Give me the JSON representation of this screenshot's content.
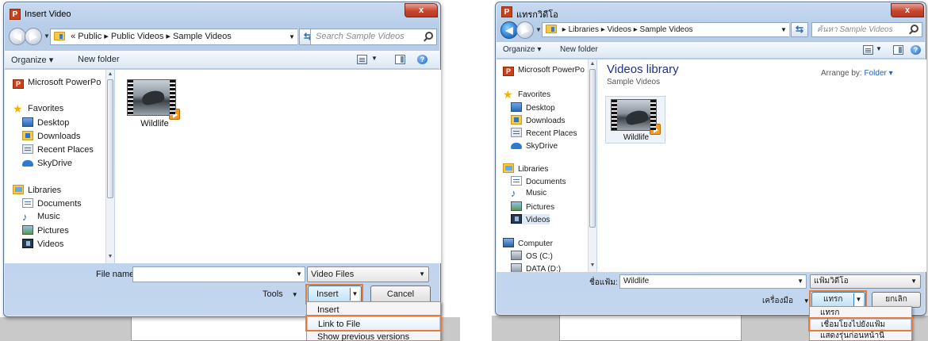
{
  "left": {
    "title": "Insert Video",
    "address": {
      "overflow": "«",
      "crumbs": [
        "Public",
        "Public Videos",
        "Sample Videos"
      ],
      "separator": "▸"
    },
    "search_placeholder": "Search Sample Videos",
    "toolbar": {
      "organize": "Organize ▾",
      "new_folder": "New folder"
    },
    "nav": {
      "pinned": "Microsoft PowerPo",
      "favorites": "Favorites",
      "favorite_items": [
        "Desktop",
        "Downloads",
        "Recent Places",
        "SkyDrive"
      ],
      "libraries": "Libraries",
      "library_items": [
        "Documents",
        "Music",
        "Pictures",
        "Videos"
      ]
    },
    "file": {
      "name": "Wildlife"
    },
    "file_name_label": "File name:",
    "file_name_value": "",
    "file_type": "Video Files",
    "tools": "Tools",
    "insert_button": "Insert",
    "cancel_button": "Cancel",
    "menu": [
      "Insert",
      "Link to File",
      "Show previous versions"
    ]
  },
  "right": {
    "title": "แทรกวิดีโอ",
    "address": {
      "crumbs": [
        "Libraries",
        "Videos",
        "Sample Videos"
      ],
      "separator": "▸"
    },
    "search_placeholder": "ค้นหา Sample Videos",
    "toolbar": {
      "organize": "Organize ▾",
      "new_folder": "New folder"
    },
    "nav": {
      "pinned": "Microsoft PowerPo",
      "favorites": "Favorites",
      "favorite_items": [
        "Desktop",
        "Downloads",
        "Recent Places",
        "SkyDrive"
      ],
      "libraries": "Libraries",
      "library_items": [
        "Documents",
        "Music",
        "Pictures",
        "Videos"
      ],
      "computer": "Computer",
      "drives": [
        "OS (C:)",
        "DATA (D:)"
      ]
    },
    "library_title": "Videos library",
    "library_subtitle": "Sample Videos",
    "arrange_label": "Arrange by:",
    "arrange_value": "Folder ▾",
    "file": {
      "name": "Wildlife"
    },
    "file_name_label": "ชื่อแฟ้ม:",
    "file_name_value": "Wildlife",
    "file_type": "แฟ้มวิดีโอ",
    "tools": "เครื่องมือ",
    "insert_button": "แทรก",
    "cancel_button": "ยกเลิก",
    "menu": [
      "แทรก",
      "เชื่อมโยงไปยังแฟ้ม",
      "แสดงรุ่นก่อนหน้านี้"
    ]
  },
  "colors": {
    "highlight": "#e97a3a",
    "close": "#c7452f",
    "link": "#1e3287"
  },
  "icons": [
    "back-arrow-icon",
    "forward-arrow-icon",
    "folder-icon",
    "refresh-icon",
    "search-icon",
    "help-icon",
    "play-icon"
  ]
}
